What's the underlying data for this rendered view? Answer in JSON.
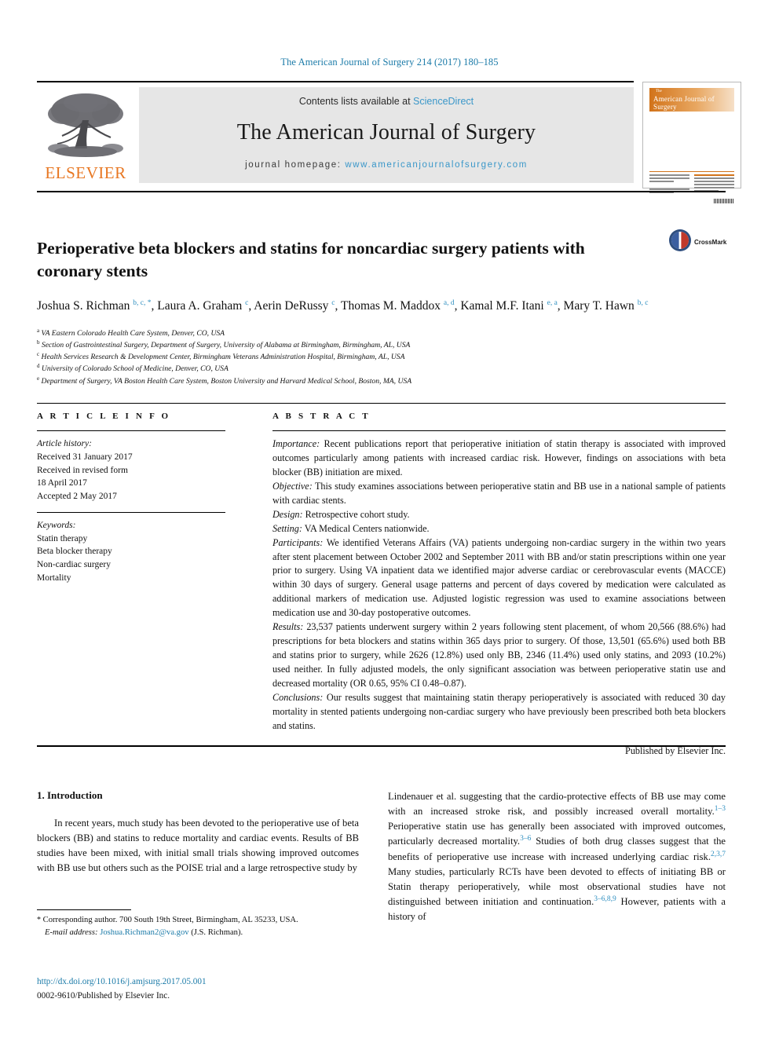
{
  "running_head": "The American Journal of Surgery 214 (2017) 180–185",
  "masthead": {
    "publisher_name": "ELSEVIER",
    "publisher_logo_icon": "elsevier-tree-icon",
    "contents_prefix": "Contents lists available at ",
    "contents_link": "ScienceDirect",
    "journal_title": "The American Journal of Surgery",
    "homepage_prefix": "journal homepage: ",
    "homepage_url": "www.americanjournalofsurgery.com"
  },
  "cover_thumb": {
    "title_small": "The",
    "title_main": "American Journal of Surgery"
  },
  "article": {
    "title": "Perioperative beta blockers and statins for noncardiac surgery patients with coronary stents",
    "crossmark_label": "CrossMark",
    "crossmark_icon": "crossmark-icon",
    "authors_html": "Joshua S. Richman <sup>b, c, *</sup>, Laura A. Graham <sup>c</sup>, Aerin DeRussy <sup>c</sup>, Thomas M. Maddox <sup>a, d</sup>, Kamal M.F. Itani <sup>e, a</sup>, Mary T. Hawn <sup>b, c</sup>",
    "affiliations": [
      {
        "marker": "a",
        "text": "VA Eastern Colorado Health Care System, Denver, CO, USA"
      },
      {
        "marker": "b",
        "text": "Section of Gastrointestinal Surgery, Department of Surgery, University of Alabama at Birmingham, Birmingham, AL, USA"
      },
      {
        "marker": "c",
        "text": "Health Services Research & Development Center, Birmingham Veterans Administration Hospital, Birmingham, AL, USA"
      },
      {
        "marker": "d",
        "text": "University of Colorado School of Medicine, Denver, CO, USA"
      },
      {
        "marker": "e",
        "text": "Department of Surgery, VA Boston Health Care System, Boston University and Harvard Medical School, Boston, MA, USA"
      }
    ]
  },
  "article_info": {
    "heading": "A R T I C L E  I N F O",
    "history_label": "Article history:",
    "history_lines": [
      "Received 31 January 2017",
      "Received in revised form",
      "18 April 2017",
      "Accepted 2 May 2017"
    ],
    "keywords_label": "Keywords:",
    "keywords": [
      "Statin therapy",
      "Beta blocker therapy",
      "Non-cardiac surgery",
      "Mortality"
    ]
  },
  "abstract": {
    "heading": "A B S T R A C T",
    "sections": [
      {
        "label": "Importance:",
        "text": " Recent publications report that perioperative initiation of statin therapy is associated with improved outcomes particularly among patients with increased cardiac risk. However, findings on associations with beta blocker (BB) initiation are mixed."
      },
      {
        "label": "Objective:",
        "text": " This study examines associations between perioperative statin and BB use in a national sample of patients with cardiac stents."
      },
      {
        "label": "Design:",
        "text": " Retrospective cohort study."
      },
      {
        "label": "Setting:",
        "text": " VA Medical Centers nationwide."
      },
      {
        "label": "Participants:",
        "text": " We identified Veterans Affairs (VA) patients undergoing non-cardiac surgery in the within two years after stent placement between October 2002 and September 2011 with BB and/or statin prescriptions within one year prior to surgery. Using VA inpatient data we identified major adverse cardiac or cerebrovascular events (MACCE) within 30 days of surgery. General usage patterns and percent of days covered by medication were calculated as additional markers of medication use. Adjusted logistic regression was used to examine associations between medication use and 30-day postoperative outcomes."
      },
      {
        "label": "Results:",
        "text": " 23,537 patients underwent surgery within 2 years following stent placement, of whom 20,566 (88.6%) had prescriptions for beta blockers and statins within 365 days prior to surgery. Of those, 13,501 (65.6%) used both BB and statins prior to surgery, while 2626 (12.8%) used only BB, 2346 (11.4%) used only statins, and 2093 (10.2%) used neither. In fully adjusted models, the only significant association was between perioperative statin use and decreased mortality (OR 0.65, 95% CI 0.48–0.87)."
      },
      {
        "label": "Conclusions:",
        "text": " Our results suggest that maintaining statin therapy perioperatively is associated with reduced 30 day mortality in stented patients undergoing non-cardiac surgery who have previously been prescribed both beta blockers and statins."
      }
    ],
    "published_by": "Published by Elsevier Inc."
  },
  "body": {
    "section_number_title": "1. Introduction",
    "left_paragraph": "In recent years, much study has been devoted to the perioperative use of beta blockers (BB) and statins to reduce mortality and cardiac events. Results of BB studies have been mixed, with initial small trials showing improved outcomes with BB use but others such as the POISE trial and a large retrospective study by",
    "right_paragraph_html": "Lindenauer et al. suggesting that the cardio-protective effects of BB use may come with an increased stroke risk, and possibly increased overall mortality.<sup class=\"sup-link\">1–3</sup> Perioperative statin use has generally been associated with improved outcomes, particularly decreased mortality.<sup class=\"sup-link\">3–6</sup> Studies of both drug classes suggest that the benefits of perioperative use increase with increased underlying cardiac risk.<sup class=\"sup-link\">2,3,7</sup> Many studies, particularly RCTs have been devoted to effects of initiating BB or Statin therapy perioperatively, while most observational studies have not distinguished between initiation and continuation.<sup class=\"sup-link\">3–6,8,9</sup> However, patients with a history of"
  },
  "footnotes": {
    "corresponding_html": "<span class=\"star\">*</span> Corresponding author. 700 South 19th Street, Birmingham, AL 35233, USA.",
    "email_label": "E-mail address:",
    "email": "Joshua.Richman2@va.gov",
    "email_suffix": " (J.S. Richman).",
    "doi": "http://dx.doi.org/10.1016/j.amjsurg.2017.05.001",
    "issn": "0002-9610/Published by Elsevier Inc."
  },
  "colors": {
    "link_blue": "#1a7aa8",
    "sciencedirect_blue": "#3a97c9",
    "elsevier_orange": "#E87722",
    "band_gray": "#e6e6e6"
  }
}
